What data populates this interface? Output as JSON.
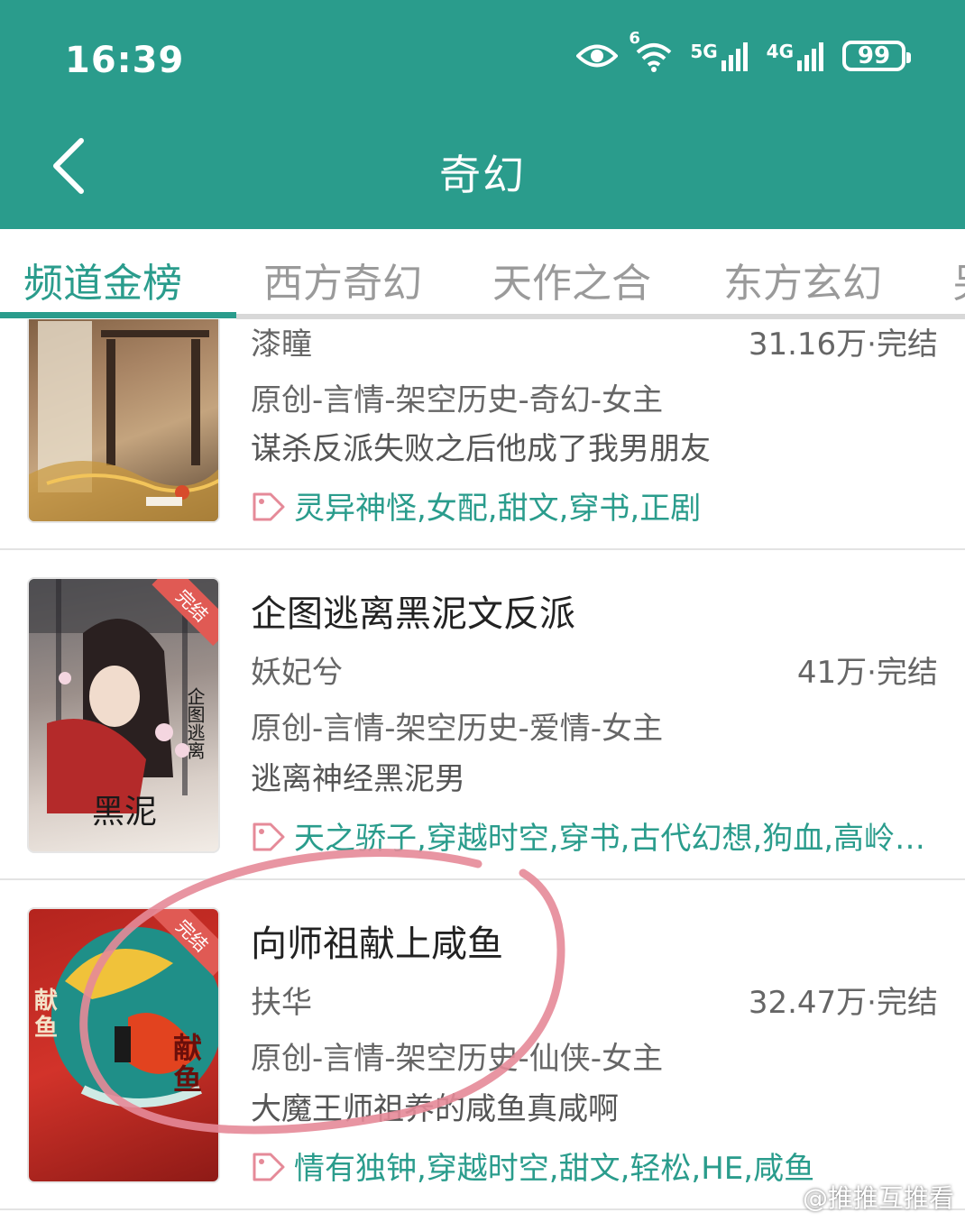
{
  "status": {
    "time": "16:39",
    "wifi_badge": "6",
    "net1": "5G",
    "net2": "4G",
    "battery": "99",
    "icons": [
      "eye-icon",
      "wifi-icon",
      "signal-5g-icon",
      "signal-4g-icon",
      "battery-icon"
    ]
  },
  "header": {
    "title": "奇幻",
    "back_icon": "chevron-left-icon"
  },
  "tabs": [
    {
      "label": "频道金榜",
      "active": true
    },
    {
      "label": "西方奇幻",
      "active": false
    },
    {
      "label": "天作之合",
      "active": false
    },
    {
      "label": "东方玄幻",
      "active": false
    },
    {
      "label": "另",
      "active": false
    }
  ],
  "books": [
    {
      "title": "",
      "author": "漆瞳",
      "stats": "31.16万·完结",
      "category": "原创-言情-架空历史-奇幻-女主",
      "desc": "谋杀反派失败之后他成了我男朋友",
      "tags": "灵异神怪,女配,甜文,穿书,正剧",
      "badge": ""
    },
    {
      "title": "企图逃离黑泥文反派",
      "author": "妖妃兮",
      "stats": "41万·完结",
      "category": "原创-言情-架空历史-爱情-女主",
      "desc": "逃离神经黑泥男",
      "tags": "天之骄子,穿越时空,穿书,古代幻想,狗血,高岭…",
      "badge": "完结"
    },
    {
      "title": "向师祖献上咸鱼",
      "author": "扶华",
      "stats": "32.47万·完结",
      "category": "原创-言情-架空历史-仙侠-女主",
      "desc": "大魔王师祖养的咸鱼真咸啊",
      "tags": "情有独钟,穿越时空,甜文,轻松,HE,咸鱼",
      "badge": "完结"
    }
  ],
  "watermark": "@推推互推看",
  "colors": {
    "brand": "#2a9c8c",
    "highlight_circle": "#e58a98",
    "badge": "#e05a54"
  }
}
